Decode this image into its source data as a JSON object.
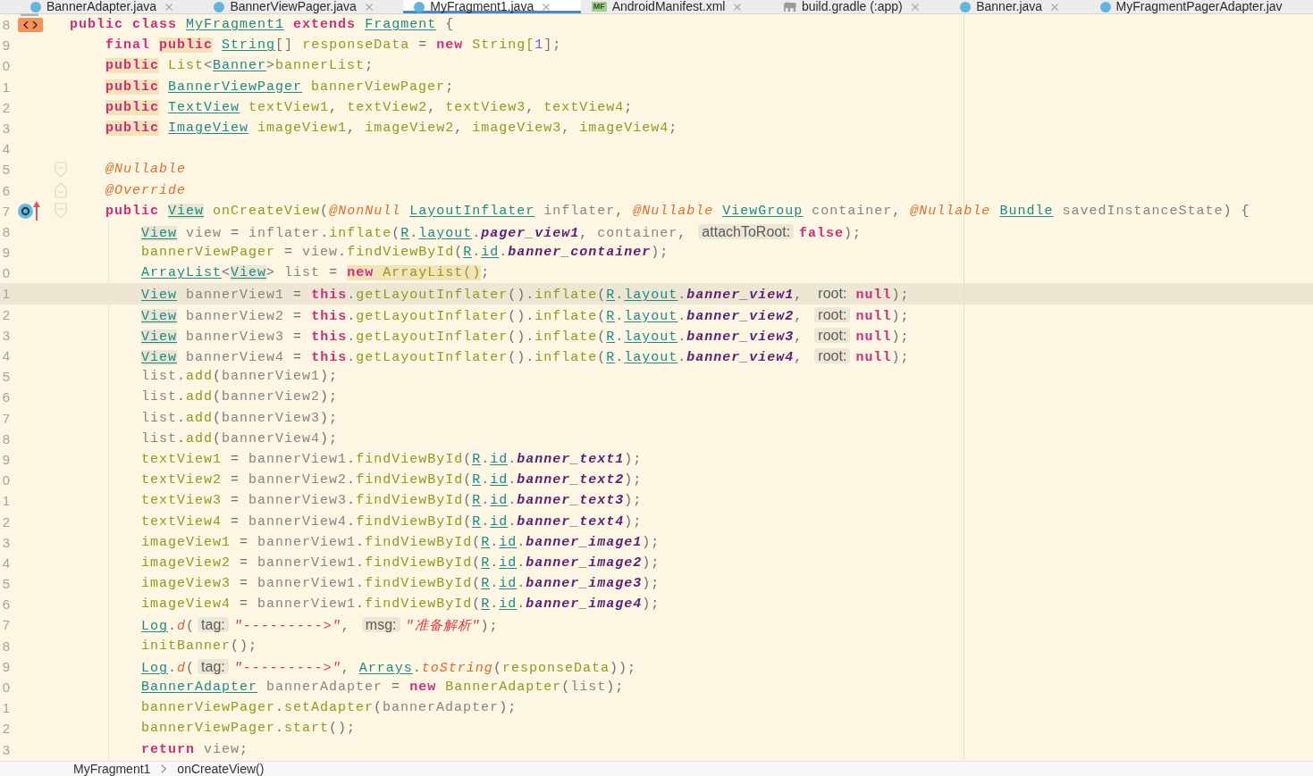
{
  "tabs": [
    {
      "kind": "java",
      "label": "BannerAdapter.java",
      "selected": false,
      "closable": true
    },
    {
      "kind": "java",
      "label": "BannerViewPager.java",
      "selected": false,
      "closable": true
    },
    {
      "kind": "java",
      "label": "MyFragment1.java",
      "selected": true,
      "closable": true
    },
    {
      "kind": "manifest",
      "badge": "MF",
      "label": "AndroidManifest.xml",
      "selected": false,
      "closable": true
    },
    {
      "kind": "gradle",
      "label": "build.gradle (:app)",
      "selected": false,
      "closable": true
    },
    {
      "kind": "java",
      "label": "Banner.java",
      "selected": false,
      "closable": true
    },
    {
      "kind": "java",
      "label": "MyFragmentPagerAdapter.jav",
      "selected": false,
      "closable": false
    }
  ],
  "editor": {
    "lines": [
      {
        "number": "8",
        "current": false,
        "gutter": [
          {
            "kind": "tag"
          }
        ],
        "code": [
          {
            "kind": "keyword",
            "text": "public class "
          },
          {
            "kind": "type",
            "text": "MyFragment1"
          },
          {
            "kind": "keyword",
            "text": " extends "
          },
          {
            "kind": "type",
            "text": "Fragment"
          },
          {
            "kind": "punct",
            "text": " {"
          }
        ]
      },
      {
        "number": "9",
        "current": false,
        "code": [
          {
            "kind": "keyword",
            "text": "    final "
          },
          {
            "kind": "warning",
            "code": [
              {
                "kind": "keyword",
                "text": "public"
              }
            ]
          },
          {
            "kind": "type",
            "text": " String"
          },
          {
            "kind": "punct",
            "text": "[] "
          },
          {
            "kind": "ident",
            "text": "responseData"
          },
          {
            "kind": "punct",
            "text": " = "
          },
          {
            "kind": "keyword",
            "text": "new "
          },
          {
            "kind": "ident",
            "text": "String["
          },
          {
            "kind": "number",
            "text": "1"
          },
          {
            "kind": "punct",
            "text": "];"
          }
        ]
      },
      {
        "number": "0",
        "current": false,
        "code": [
          {
            "kind": "warning",
            "code": [
              {
                "kind": "keyword",
                "text": "    public"
              }
            ]
          },
          {
            "kind": "ident",
            "text": " List"
          },
          {
            "kind": "punct",
            "text": "<"
          },
          {
            "kind": "type",
            "text": "Banner"
          },
          {
            "kind": "punct",
            "text": ">"
          },
          {
            "kind": "ident",
            "text": "bannerList"
          },
          {
            "kind": "punct",
            "text": ";"
          }
        ]
      },
      {
        "number": "1",
        "current": false,
        "code": [
          {
            "kind": "warning",
            "code": [
              {
                "kind": "keyword",
                "text": "    public"
              }
            ]
          },
          {
            "kind": "type",
            "text": " BannerViewPager"
          },
          {
            "kind": "ident",
            "text": " bannerViewPager"
          },
          {
            "kind": "punct",
            "text": ";"
          }
        ]
      },
      {
        "number": "2",
        "current": false,
        "code": [
          {
            "kind": "warning",
            "code": [
              {
                "kind": "keyword",
                "text": "    public"
              }
            ]
          },
          {
            "kind": "type",
            "text": " TextView"
          },
          {
            "kind": "ident",
            "text": " textView1"
          },
          {
            "kind": "punct",
            "text": ", "
          },
          {
            "kind": "ident",
            "text": "textView2"
          },
          {
            "kind": "punct",
            "text": ", "
          },
          {
            "kind": "ident",
            "text": "textView3"
          },
          {
            "kind": "punct",
            "text": ", "
          },
          {
            "kind": "ident",
            "text": "textView4"
          },
          {
            "kind": "punct",
            "text": ";"
          }
        ]
      },
      {
        "number": "3",
        "current": false,
        "code": [
          {
            "kind": "warning",
            "code": [
              {
                "kind": "keyword",
                "text": "    public"
              }
            ]
          },
          {
            "kind": "type",
            "text": " ImageView"
          },
          {
            "kind": "ident",
            "text": " imageView1"
          },
          {
            "kind": "punct",
            "text": ", "
          },
          {
            "kind": "ident",
            "text": "imageView2"
          },
          {
            "kind": "punct",
            "text": ", "
          },
          {
            "kind": "ident",
            "text": "imageView3"
          },
          {
            "kind": "punct",
            "text": ", "
          },
          {
            "kind": "ident",
            "text": "imageView4"
          },
          {
            "kind": "punct",
            "text": ";"
          }
        ]
      },
      {
        "number": "4",
        "current": false
      },
      {
        "number": "5",
        "current": false,
        "fold": {
          "kind": "start"
        },
        "code": [
          {
            "kind": "annotation",
            "text": "    @Nullable"
          }
        ]
      },
      {
        "number": "6",
        "current": false,
        "fold": {
          "kind": "end"
        },
        "code": [
          {
            "kind": "annotation",
            "text": "    @Override"
          }
        ]
      },
      {
        "number": "7",
        "current": false,
        "fold": {
          "kind": "start"
        },
        "gutter": [
          {
            "kind": "override"
          },
          {
            "kind": "arrow"
          }
        ],
        "code": [
          {
            "kind": "keyword",
            "text": "    public "
          },
          {
            "kind": "usage",
            "code": [
              {
                "kind": "type",
                "text": "View"
              }
            ]
          },
          {
            "kind": "ident",
            "text": " onCreateView"
          },
          {
            "kind": "punct",
            "text": "("
          },
          {
            "kind": "annotation",
            "text": "@NonNull "
          },
          {
            "kind": "type",
            "text": "LayoutInflater"
          },
          {
            "kind": "param",
            "text": " inflater"
          },
          {
            "kind": "punct",
            "text": ", "
          },
          {
            "kind": "annotation",
            "text": "@Nullable "
          },
          {
            "kind": "type",
            "text": "ViewGroup"
          },
          {
            "kind": "param",
            "text": " container"
          },
          {
            "kind": "punct",
            "text": ", "
          },
          {
            "kind": "annotation",
            "text": "@Nullable "
          },
          {
            "kind": "type",
            "text": "Bundle"
          },
          {
            "kind": "param",
            "text": " savedInstanceState"
          },
          {
            "kind": "punct",
            "text": ") {"
          }
        ]
      },
      {
        "number": "8",
        "current": false,
        "code": [
          {
            "kind": "usage",
            "code": [
              {
                "kind": "type",
                "text": "        View"
              }
            ]
          },
          {
            "kind": "param",
            "text": " view"
          },
          {
            "kind": "punct",
            "text": " = "
          },
          {
            "kind": "param",
            "text": "inflater"
          },
          {
            "kind": "punct",
            "text": "."
          },
          {
            "kind": "ident",
            "text": "inflate"
          },
          {
            "kind": "punct",
            "text": "("
          },
          {
            "kind": "type",
            "text": "R"
          },
          {
            "kind": "punct",
            "text": "."
          },
          {
            "kind": "type",
            "text": "layout"
          },
          {
            "kind": "punct",
            "text": "."
          },
          {
            "kind": "constant",
            "text": "pager_view1"
          },
          {
            "kind": "punct",
            "text": ", "
          },
          {
            "kind": "param",
            "text": "container"
          },
          {
            "kind": "punct",
            "text": ", "
          },
          {
            "kind": "hint",
            "text": "attachToRoot:"
          },
          {
            "kind": "keyword",
            "text": "false"
          },
          {
            "kind": "punct",
            "text": ");"
          }
        ]
      },
      {
        "number": "9",
        "current": false,
        "code": [
          {
            "kind": "ident",
            "text": "        bannerViewPager"
          },
          {
            "kind": "punct",
            "text": " = "
          },
          {
            "kind": "param",
            "text": "view"
          },
          {
            "kind": "punct",
            "text": "."
          },
          {
            "kind": "ident",
            "text": "findViewById"
          },
          {
            "kind": "punct",
            "text": "("
          },
          {
            "kind": "type",
            "text": "R"
          },
          {
            "kind": "punct",
            "text": "."
          },
          {
            "kind": "type",
            "text": "id"
          },
          {
            "kind": "punct",
            "text": "."
          },
          {
            "kind": "constant",
            "text": "banner_container"
          },
          {
            "kind": "punct",
            "text": ");"
          }
        ]
      },
      {
        "number": "0",
        "current": false,
        "code": [
          {
            "kind": "type",
            "text": "        ArrayList"
          },
          {
            "kind": "punct",
            "text": "<"
          },
          {
            "kind": "usage",
            "code": [
              {
                "kind": "type",
                "text": "View"
              }
            ]
          },
          {
            "kind": "punct",
            "text": "> "
          },
          {
            "kind": "param",
            "text": "list"
          },
          {
            "kind": "punct",
            "text": " = "
          },
          {
            "kind": "warning",
            "code": [
              {
                "kind": "keyword",
                "text": "new "
              },
              {
                "kind": "ident",
                "text": "ArrayList()"
              }
            ]
          },
          {
            "kind": "punct",
            "text": ";"
          }
        ]
      },
      {
        "number": "1",
        "current": true,
        "code": [
          {
            "kind": "usage",
            "code": [
              {
                "kind": "type",
                "text": "        View"
              }
            ]
          },
          {
            "kind": "param",
            "text": " bannerView1"
          },
          {
            "kind": "punct",
            "text": " = "
          },
          {
            "kind": "keyword",
            "text": "this"
          },
          {
            "kind": "punct",
            "text": "."
          },
          {
            "kind": "ident",
            "text": "getLayoutInflater"
          },
          {
            "kind": "punct",
            "text": "()."
          },
          {
            "kind": "ident",
            "text": "inflate"
          },
          {
            "kind": "punct",
            "text": "("
          },
          {
            "kind": "type",
            "text": "R"
          },
          {
            "kind": "punct",
            "text": "."
          },
          {
            "kind": "type",
            "text": "layout"
          },
          {
            "kind": "punct",
            "text": "."
          },
          {
            "kind": "constant",
            "text": "banner_view1"
          },
          {
            "kind": "punct",
            "text": ", "
          },
          {
            "kind": "hint",
            "text": "root:"
          },
          {
            "kind": "keyword",
            "text": "null"
          },
          {
            "kind": "punct",
            "text": ");"
          }
        ]
      },
      {
        "number": "2",
        "current": false,
        "code": [
          {
            "kind": "usage",
            "code": [
              {
                "kind": "type",
                "text": "        View"
              }
            ]
          },
          {
            "kind": "param",
            "text": " bannerView2"
          },
          {
            "kind": "punct",
            "text": " = "
          },
          {
            "kind": "keyword",
            "text": "this"
          },
          {
            "kind": "punct",
            "text": "."
          },
          {
            "kind": "ident",
            "text": "getLayoutInflater"
          },
          {
            "kind": "punct",
            "text": "()."
          },
          {
            "kind": "ident",
            "text": "inflate"
          },
          {
            "kind": "punct",
            "text": "("
          },
          {
            "kind": "type",
            "text": "R"
          },
          {
            "kind": "punct",
            "text": "."
          },
          {
            "kind": "type",
            "text": "layout"
          },
          {
            "kind": "punct",
            "text": "."
          },
          {
            "kind": "constant",
            "text": "banner_view2"
          },
          {
            "kind": "punct",
            "text": ", "
          },
          {
            "kind": "hint",
            "text": "root:"
          },
          {
            "kind": "keyword",
            "text": "null"
          },
          {
            "kind": "punct",
            "text": ");"
          }
        ]
      },
      {
        "number": "3",
        "current": false,
        "code": [
          {
            "kind": "usage",
            "code": [
              {
                "kind": "type",
                "text": "        View"
              }
            ]
          },
          {
            "kind": "param",
            "text": " bannerView3"
          },
          {
            "kind": "punct",
            "text": " = "
          },
          {
            "kind": "keyword",
            "text": "this"
          },
          {
            "kind": "punct",
            "text": "."
          },
          {
            "kind": "ident",
            "text": "getLayoutInflater"
          },
          {
            "kind": "punct",
            "text": "()."
          },
          {
            "kind": "ident",
            "text": "inflate"
          },
          {
            "kind": "punct",
            "text": "("
          },
          {
            "kind": "type",
            "text": "R"
          },
          {
            "kind": "punct",
            "text": "."
          },
          {
            "kind": "type",
            "text": "layout"
          },
          {
            "kind": "punct",
            "text": "."
          },
          {
            "kind": "constant",
            "text": "banner_view3"
          },
          {
            "kind": "punct",
            "text": ", "
          },
          {
            "kind": "hint",
            "text": "root:"
          },
          {
            "kind": "keyword",
            "text": "null"
          },
          {
            "kind": "punct",
            "text": ");"
          }
        ]
      },
      {
        "number": "4",
        "current": false,
        "code": [
          {
            "kind": "usage",
            "code": [
              {
                "kind": "type",
                "text": "        View"
              }
            ]
          },
          {
            "kind": "param",
            "text": " bannerView4"
          },
          {
            "kind": "punct",
            "text": " = "
          },
          {
            "kind": "keyword",
            "text": "this"
          },
          {
            "kind": "punct",
            "text": "."
          },
          {
            "kind": "ident",
            "text": "getLayoutInflater"
          },
          {
            "kind": "punct",
            "text": "()."
          },
          {
            "kind": "ident",
            "text": "inflate"
          },
          {
            "kind": "punct",
            "text": "("
          },
          {
            "kind": "type",
            "text": "R"
          },
          {
            "kind": "punct",
            "text": "."
          },
          {
            "kind": "type",
            "text": "layout"
          },
          {
            "kind": "punct",
            "text": "."
          },
          {
            "kind": "constant",
            "text": "banner_view4"
          },
          {
            "kind": "punct",
            "text": ", "
          },
          {
            "kind": "hint",
            "text": "root:"
          },
          {
            "kind": "keyword",
            "text": "null"
          },
          {
            "kind": "punct",
            "text": ");"
          }
        ]
      },
      {
        "number": "5",
        "current": false,
        "code": [
          {
            "kind": "param",
            "text": "        list"
          },
          {
            "kind": "punct",
            "text": "."
          },
          {
            "kind": "ident",
            "text": "add"
          },
          {
            "kind": "punct",
            "text": "("
          },
          {
            "kind": "param",
            "text": "bannerView1"
          },
          {
            "kind": "punct",
            "text": ");"
          }
        ]
      },
      {
        "number": "6",
        "current": false,
        "code": [
          {
            "kind": "param",
            "text": "        list"
          },
          {
            "kind": "punct",
            "text": "."
          },
          {
            "kind": "ident",
            "text": "add"
          },
          {
            "kind": "punct",
            "text": "("
          },
          {
            "kind": "param",
            "text": "bannerView2"
          },
          {
            "kind": "punct",
            "text": ");"
          }
        ]
      },
      {
        "number": "7",
        "current": false,
        "code": [
          {
            "kind": "param",
            "text": "        list"
          },
          {
            "kind": "punct",
            "text": "."
          },
          {
            "kind": "ident",
            "text": "add"
          },
          {
            "kind": "punct",
            "text": "("
          },
          {
            "kind": "param",
            "text": "bannerView3"
          },
          {
            "kind": "punct",
            "text": ");"
          }
        ]
      },
      {
        "number": "8",
        "current": false,
        "code": [
          {
            "kind": "param",
            "text": "        list"
          },
          {
            "kind": "punct",
            "text": "."
          },
          {
            "kind": "ident",
            "text": "add"
          },
          {
            "kind": "punct",
            "text": "("
          },
          {
            "kind": "param",
            "text": "bannerView4"
          },
          {
            "kind": "punct",
            "text": ");"
          }
        ]
      },
      {
        "number": "9",
        "current": false,
        "code": [
          {
            "kind": "ident",
            "text": "        textView1"
          },
          {
            "kind": "punct",
            "text": " = "
          },
          {
            "kind": "param",
            "text": "bannerView1"
          },
          {
            "kind": "punct",
            "text": "."
          },
          {
            "kind": "ident",
            "text": "findViewById"
          },
          {
            "kind": "punct",
            "text": "("
          },
          {
            "kind": "type",
            "text": "R"
          },
          {
            "kind": "punct",
            "text": "."
          },
          {
            "kind": "type",
            "text": "id"
          },
          {
            "kind": "punct",
            "text": "."
          },
          {
            "kind": "constant",
            "text": "banner_text1"
          },
          {
            "kind": "punct",
            "text": ");"
          }
        ]
      },
      {
        "number": "0",
        "current": false,
        "code": [
          {
            "kind": "ident",
            "text": "        textView2"
          },
          {
            "kind": "punct",
            "text": " = "
          },
          {
            "kind": "param",
            "text": "bannerView2"
          },
          {
            "kind": "punct",
            "text": "."
          },
          {
            "kind": "ident",
            "text": "findViewById"
          },
          {
            "kind": "punct",
            "text": "("
          },
          {
            "kind": "type",
            "text": "R"
          },
          {
            "kind": "punct",
            "text": "."
          },
          {
            "kind": "type",
            "text": "id"
          },
          {
            "kind": "punct",
            "text": "."
          },
          {
            "kind": "constant",
            "text": "banner_text2"
          },
          {
            "kind": "punct",
            "text": ");"
          }
        ]
      },
      {
        "number": "1",
        "current": false,
        "code": [
          {
            "kind": "ident",
            "text": "        textView3"
          },
          {
            "kind": "punct",
            "text": " = "
          },
          {
            "kind": "param",
            "text": "bannerView3"
          },
          {
            "kind": "punct",
            "text": "."
          },
          {
            "kind": "ident",
            "text": "findViewById"
          },
          {
            "kind": "punct",
            "text": "("
          },
          {
            "kind": "type",
            "text": "R"
          },
          {
            "kind": "punct",
            "text": "."
          },
          {
            "kind": "type",
            "text": "id"
          },
          {
            "kind": "punct",
            "text": "."
          },
          {
            "kind": "constant",
            "text": "banner_text3"
          },
          {
            "kind": "punct",
            "text": ");"
          }
        ]
      },
      {
        "number": "2",
        "current": false,
        "code": [
          {
            "kind": "ident",
            "text": "        textView4"
          },
          {
            "kind": "punct",
            "text": " = "
          },
          {
            "kind": "param",
            "text": "bannerView4"
          },
          {
            "kind": "punct",
            "text": "."
          },
          {
            "kind": "ident",
            "text": "findViewById"
          },
          {
            "kind": "punct",
            "text": "("
          },
          {
            "kind": "type",
            "text": "R"
          },
          {
            "kind": "punct",
            "text": "."
          },
          {
            "kind": "type",
            "text": "id"
          },
          {
            "kind": "punct",
            "text": "."
          },
          {
            "kind": "constant",
            "text": "banner_text4"
          },
          {
            "kind": "punct",
            "text": ");"
          }
        ]
      },
      {
        "number": "3",
        "current": false,
        "code": [
          {
            "kind": "ident",
            "text": "        imageView1"
          },
          {
            "kind": "punct",
            "text": " = "
          },
          {
            "kind": "param",
            "text": "bannerView1"
          },
          {
            "kind": "punct",
            "text": "."
          },
          {
            "kind": "ident",
            "text": "findViewById"
          },
          {
            "kind": "punct",
            "text": "("
          },
          {
            "kind": "type",
            "text": "R"
          },
          {
            "kind": "punct",
            "text": "."
          },
          {
            "kind": "type",
            "text": "id"
          },
          {
            "kind": "punct",
            "text": "."
          },
          {
            "kind": "constant",
            "text": "banner_image1"
          },
          {
            "kind": "punct",
            "text": ");"
          }
        ]
      },
      {
        "number": "4",
        "current": false,
        "code": [
          {
            "kind": "ident",
            "text": "        imageView2"
          },
          {
            "kind": "punct",
            "text": " = "
          },
          {
            "kind": "param",
            "text": "bannerView1"
          },
          {
            "kind": "punct",
            "text": "."
          },
          {
            "kind": "ident",
            "text": "findViewById"
          },
          {
            "kind": "punct",
            "text": "("
          },
          {
            "kind": "type",
            "text": "R"
          },
          {
            "kind": "punct",
            "text": "."
          },
          {
            "kind": "type",
            "text": "id"
          },
          {
            "kind": "punct",
            "text": "."
          },
          {
            "kind": "constant",
            "text": "banner_image2"
          },
          {
            "kind": "punct",
            "text": ");"
          }
        ]
      },
      {
        "number": "5",
        "current": false,
        "code": [
          {
            "kind": "ident",
            "text": "        imageView3"
          },
          {
            "kind": "punct",
            "text": " = "
          },
          {
            "kind": "param",
            "text": "bannerView1"
          },
          {
            "kind": "punct",
            "text": "."
          },
          {
            "kind": "ident",
            "text": "findViewById"
          },
          {
            "kind": "punct",
            "text": "("
          },
          {
            "kind": "type",
            "text": "R"
          },
          {
            "kind": "punct",
            "text": "."
          },
          {
            "kind": "type",
            "text": "id"
          },
          {
            "kind": "punct",
            "text": "."
          },
          {
            "kind": "constant",
            "text": "banner_image3"
          },
          {
            "kind": "punct",
            "text": ");"
          }
        ]
      },
      {
        "number": "6",
        "current": false,
        "code": [
          {
            "kind": "ident",
            "text": "        imageView4"
          },
          {
            "kind": "punct",
            "text": " = "
          },
          {
            "kind": "param",
            "text": "bannerView1"
          },
          {
            "kind": "punct",
            "text": "."
          },
          {
            "kind": "ident",
            "text": "findViewById"
          },
          {
            "kind": "punct",
            "text": "("
          },
          {
            "kind": "type",
            "text": "R"
          },
          {
            "kind": "punct",
            "text": "."
          },
          {
            "kind": "type",
            "text": "id"
          },
          {
            "kind": "punct",
            "text": "."
          },
          {
            "kind": "constant",
            "text": "banner_image4"
          },
          {
            "kind": "punct",
            "text": ");"
          }
        ]
      },
      {
        "number": "7",
        "current": false,
        "code": [
          {
            "kind": "type",
            "text": "        Log"
          },
          {
            "kind": "punct",
            "text": "."
          },
          {
            "kind": "call",
            "text": "d"
          },
          {
            "kind": "punct",
            "text": "("
          },
          {
            "kind": "hint",
            "text": "tag:"
          },
          {
            "kind": "string",
            "text": "\"--------->\""
          },
          {
            "kind": "punct",
            "text": ", "
          },
          {
            "kind": "hint",
            "text": "msg:"
          },
          {
            "kind": "string",
            "text": "\"准备解析\""
          },
          {
            "kind": "punct",
            "text": ");"
          }
        ]
      },
      {
        "number": "8",
        "current": false,
        "code": [
          {
            "kind": "ident",
            "text": "        initBanner"
          },
          {
            "kind": "punct",
            "text": "();"
          }
        ]
      },
      {
        "number": "9",
        "current": false,
        "code": [
          {
            "kind": "type",
            "text": "        Log"
          },
          {
            "kind": "punct",
            "text": "."
          },
          {
            "kind": "call",
            "text": "d"
          },
          {
            "kind": "punct",
            "text": "("
          },
          {
            "kind": "hint",
            "text": "tag:"
          },
          {
            "kind": "string",
            "text": "\"--------->\""
          },
          {
            "kind": "punct",
            "text": ", "
          },
          {
            "kind": "type",
            "text": "Arrays"
          },
          {
            "kind": "punct",
            "text": "."
          },
          {
            "kind": "call",
            "text": "toString"
          },
          {
            "kind": "punct",
            "text": "("
          },
          {
            "kind": "ident",
            "text": "responseData"
          },
          {
            "kind": "punct",
            "text": "));"
          }
        ]
      },
      {
        "number": "0",
        "current": false,
        "code": [
          {
            "kind": "type",
            "text": "        BannerAdapter"
          },
          {
            "kind": "param",
            "text": " bannerAdapter"
          },
          {
            "kind": "punct",
            "text": " = "
          },
          {
            "kind": "keyword",
            "text": "new "
          },
          {
            "kind": "ident",
            "text": "BannerAdapter"
          },
          {
            "kind": "punct",
            "text": "("
          },
          {
            "kind": "param",
            "text": "list"
          },
          {
            "kind": "punct",
            "text": ");"
          }
        ]
      },
      {
        "number": "1",
        "current": false,
        "code": [
          {
            "kind": "ident",
            "text": "        bannerViewPager"
          },
          {
            "kind": "punct",
            "text": "."
          },
          {
            "kind": "ident",
            "text": "setAdapter"
          },
          {
            "kind": "punct",
            "text": "("
          },
          {
            "kind": "param",
            "text": "bannerAdapter"
          },
          {
            "kind": "punct",
            "text": ");"
          }
        ]
      },
      {
        "number": "2",
        "current": false,
        "code": [
          {
            "kind": "ident",
            "text": "        bannerViewPager"
          },
          {
            "kind": "punct",
            "text": "."
          },
          {
            "kind": "ident",
            "text": "start"
          },
          {
            "kind": "punct",
            "text": "();"
          }
        ]
      },
      {
        "number": "3",
        "current": false,
        "code": [
          {
            "kind": "keyword",
            "text": "        return"
          },
          {
            "kind": "param",
            "text": " view"
          },
          {
            "kind": "punct",
            "text": ";"
          }
        ]
      }
    ]
  },
  "breadcrumb": [
    {
      "label": "MyFragment1"
    },
    {
      "label": "onCreateView()"
    }
  ]
}
